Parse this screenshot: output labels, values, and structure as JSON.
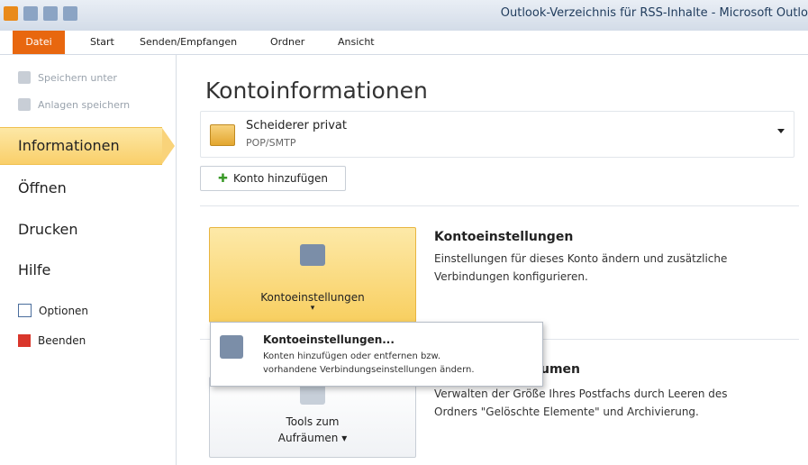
{
  "window": {
    "title": "Outlook-Verzeichnis für RSS-Inhalte - Microsoft Outlo"
  },
  "ribbon": {
    "tabs": [
      "Datei",
      "Start",
      "Senden/Empfangen",
      "Ordner",
      "Ansicht"
    ]
  },
  "nav": {
    "small_items": [
      "Speichern unter",
      "Anlagen speichern"
    ],
    "selected": "Informationen",
    "items": [
      "Öffnen",
      "Drucken",
      "Hilfe"
    ],
    "options": "Optionen",
    "exit": "Beenden"
  },
  "main": {
    "heading": "Kontoinformationen",
    "account": {
      "name": "Scheiderer privat",
      "type": "POP/SMTP"
    },
    "add_account": "Konto hinzufügen",
    "account_settings_button": "Kontoeinstellungen",
    "account_settings_title": "Kontoeinstellungen",
    "account_settings_desc_1": "Einstellungen für dieses Konto ändern und zusätzliche",
    "account_settings_desc_2": "Verbindungen konfigurieren.",
    "cleanup_title_partial": "umen",
    "cleanup_desc_1": "Verwalten der Größe Ihres Postfachs durch Leeren des",
    "cleanup_desc_2": "Ordners \"Gelöschte Elemente\" und Archivierung.",
    "tools_btn_1": "Tools zum",
    "tools_btn_2": "Aufräumen ▾"
  },
  "popup": {
    "title": "Kontoeinstellungen...",
    "desc_1": "Konten hinzufügen oder entfernen bzw.",
    "desc_2": "vorhandene Verbindungseinstellungen ändern."
  },
  "colors": {
    "accent": "#e8670f",
    "selected": "#f9cf6a"
  }
}
